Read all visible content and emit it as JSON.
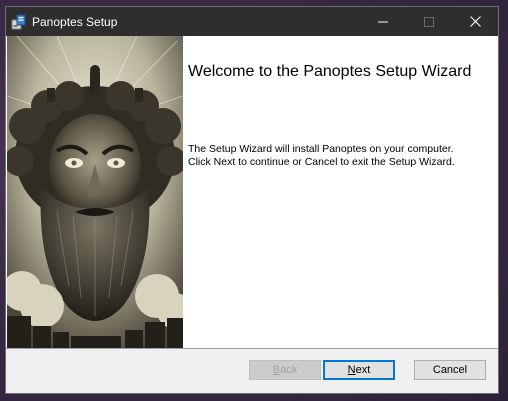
{
  "window": {
    "title": "Panoptes Setup",
    "controls": {
      "minimize_icon": "minimize-icon",
      "maximize_icon": "maximize-icon",
      "close_icon": "close-icon"
    }
  },
  "wizard": {
    "heading": "Welcome to the Panoptes Setup Wizard",
    "description_line1": "The Setup Wizard will install Panoptes on your computer.",
    "description_line2": "Click Next to continue or Cancel to exit the Setup Wizard."
  },
  "buttons": {
    "back": {
      "mnemonic": "B",
      "rest": "ack",
      "enabled": false
    },
    "next": {
      "mnemonic": "N",
      "rest": "ext",
      "enabled": true,
      "default": true
    },
    "cancel": {
      "label": "Cancel",
      "enabled": true
    }
  },
  "colors": {
    "titlebar": "#2e2e2e",
    "focus_border": "#0078d7",
    "dialog_background": "#f0f0f0"
  }
}
